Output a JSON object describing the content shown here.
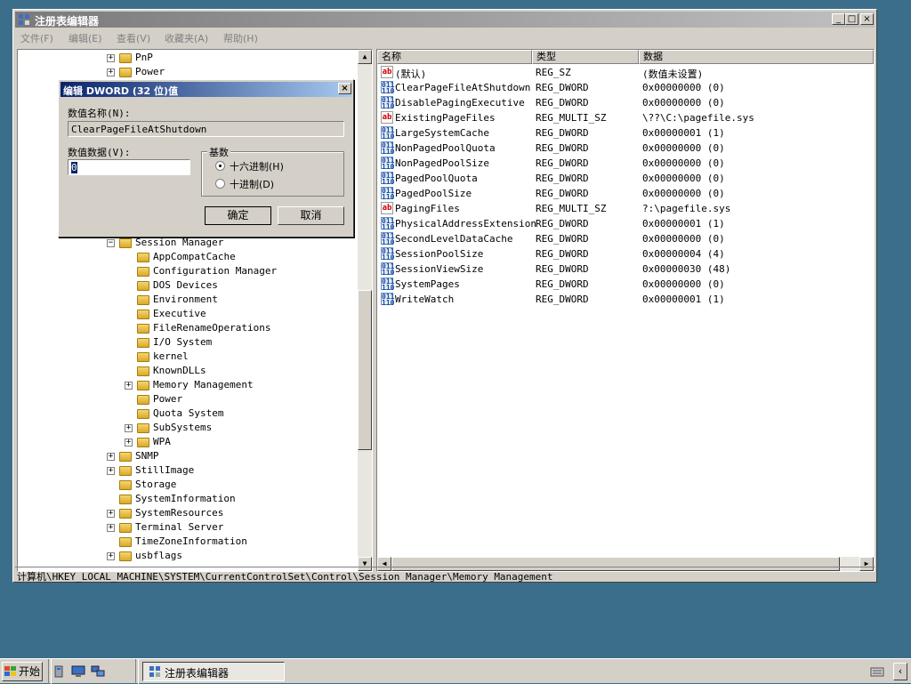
{
  "window": {
    "title": "注册表编辑器",
    "controls": {
      "minimize": "_",
      "maximize": "□",
      "close": "×"
    }
  },
  "menu": [
    "文件(F)",
    "编辑(E)",
    "查看(V)",
    "收藏夹(A)",
    "帮助(H)"
  ],
  "tree": {
    "items": [
      {
        "label": "PnP",
        "expandable": true
      },
      {
        "label": "Power",
        "expandable": true
      },
      {
        "label": "Session Manager",
        "expandable": true,
        "expanded": true
      },
      {
        "label": "AppCompatCache",
        "expandable": false
      },
      {
        "label": "Configuration Manager",
        "expandable": false
      },
      {
        "label": "DOS Devices",
        "expandable": false
      },
      {
        "label": "Environment",
        "expandable": false
      },
      {
        "label": "Executive",
        "expandable": false
      },
      {
        "label": "FileRenameOperations",
        "expandable": false
      },
      {
        "label": "I/O System",
        "expandable": false
      },
      {
        "label": "kernel",
        "expandable": false
      },
      {
        "label": "KnownDLLs",
        "expandable": false
      },
      {
        "label": "Memory Management",
        "expandable": true
      },
      {
        "label": "Power",
        "expandable": false
      },
      {
        "label": "Quota System",
        "expandable": false
      },
      {
        "label": "SubSystems",
        "expandable": true
      },
      {
        "label": "WPA",
        "expandable": true
      },
      {
        "label": "SNMP",
        "expandable": true
      },
      {
        "label": "StillImage",
        "expandable": true
      },
      {
        "label": "Storage",
        "expandable": false
      },
      {
        "label": "SystemInformation",
        "expandable": false
      },
      {
        "label": "SystemResources",
        "expandable": true
      },
      {
        "label": "Terminal Server",
        "expandable": true
      },
      {
        "label": "TimeZoneInformation",
        "expandable": false
      },
      {
        "label": "usbflags",
        "expandable": true
      }
    ]
  },
  "list": {
    "headers": [
      "名称",
      "类型",
      "数据"
    ],
    "rows": [
      {
        "icon": "ab",
        "name": "(默认)",
        "type": "REG_SZ",
        "data": "(数值未设置)"
      },
      {
        "icon": "bin",
        "name": "ClearPageFileAtShutdown",
        "type": "REG_DWORD",
        "data": "0x00000000 (0)"
      },
      {
        "icon": "bin",
        "name": "DisablePagingExecutive",
        "type": "REG_DWORD",
        "data": "0x00000000 (0)"
      },
      {
        "icon": "ab",
        "name": "ExistingPageFiles",
        "type": "REG_MULTI_SZ",
        "data": "\\??\\C:\\pagefile.sys"
      },
      {
        "icon": "bin",
        "name": "LargeSystemCache",
        "type": "REG_DWORD",
        "data": "0x00000001 (1)"
      },
      {
        "icon": "bin",
        "name": "NonPagedPoolQuota",
        "type": "REG_DWORD",
        "data": "0x00000000 (0)"
      },
      {
        "icon": "bin",
        "name": "NonPagedPoolSize",
        "type": "REG_DWORD",
        "data": "0x00000000 (0)"
      },
      {
        "icon": "bin",
        "name": "PagedPoolQuota",
        "type": "REG_DWORD",
        "data": "0x00000000 (0)"
      },
      {
        "icon": "bin",
        "name": "PagedPoolSize",
        "type": "REG_DWORD",
        "data": "0x00000000 (0)"
      },
      {
        "icon": "ab",
        "name": "PagingFiles",
        "type": "REG_MULTI_SZ",
        "data": "?:\\pagefile.sys"
      },
      {
        "icon": "bin",
        "name": "PhysicalAddressExtension",
        "type": "REG_DWORD",
        "data": "0x00000001 (1)"
      },
      {
        "icon": "bin",
        "name": "SecondLevelDataCache",
        "type": "REG_DWORD",
        "data": "0x00000000 (0)"
      },
      {
        "icon": "bin",
        "name": "SessionPoolSize",
        "type": "REG_DWORD",
        "data": "0x00000004 (4)"
      },
      {
        "icon": "bin",
        "name": "SessionViewSize",
        "type": "REG_DWORD",
        "data": "0x00000030 (48)"
      },
      {
        "icon": "bin",
        "name": "SystemPages",
        "type": "REG_DWORD",
        "data": "0x00000000 (0)"
      },
      {
        "icon": "bin",
        "name": "WriteWatch",
        "type": "REG_DWORD",
        "data": "0x00000001 (1)"
      }
    ]
  },
  "statusbar": {
    "path": "计算机\\HKEY_LOCAL_MACHINE\\SYSTEM\\CurrentControlSet\\Control\\Session Manager\\Memory Management"
  },
  "dialog": {
    "title": "编辑 DWORD (32 位)值",
    "close": "×",
    "name_label": "数值名称(N):",
    "name_value": "ClearPageFileAtShutdown",
    "data_label": "数值数据(V):",
    "data_value": "0",
    "base_label": "基数",
    "hex_label": "十六进制(H)",
    "dec_label": "十进制(D)",
    "ok": "确定",
    "cancel": "取消"
  },
  "taskbar": {
    "start": "开始",
    "task": "注册表编辑器"
  }
}
